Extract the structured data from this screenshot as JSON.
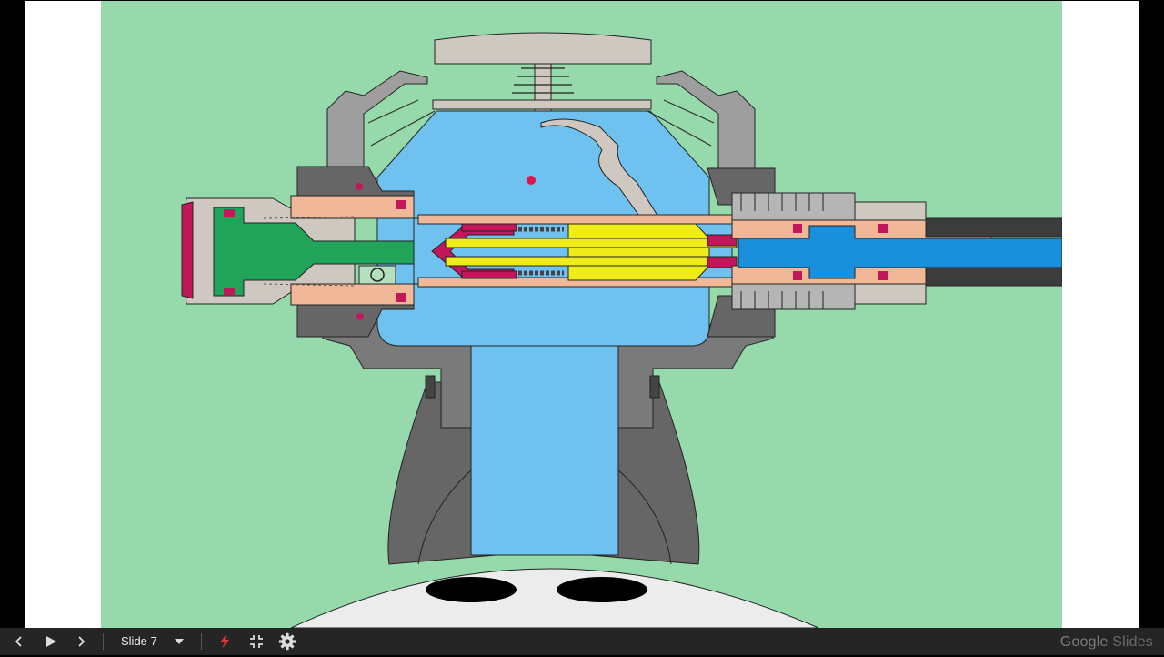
{
  "slide": {
    "background": "#96d9aa",
    "water_color": "#6fc1f0",
    "outlet_color": "#1a8fdc"
  },
  "controls": {
    "previous": "chevron-left-icon",
    "play": "play-icon",
    "next": "chevron-right-icon",
    "slide_label": "Slide 7",
    "slide_menu": "caret-down-icon",
    "laser": "laser-pointer-icon",
    "exit_fullscreen": "exit-fullscreen-icon",
    "settings": "gear-icon"
  },
  "branding": {
    "google": "Google",
    "slides": "Slides"
  }
}
